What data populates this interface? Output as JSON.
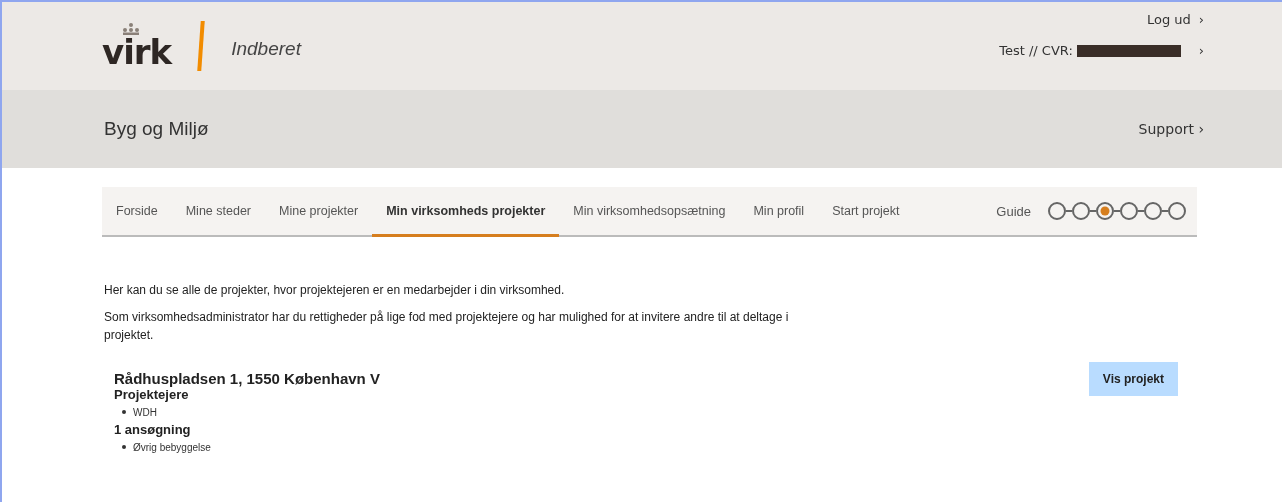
{
  "header": {
    "logo_text": "virk",
    "app_name": "Indberet",
    "logout": "Log ud",
    "chevron_logout": "›",
    "user": "Test // CVR:",
    "chevron_user": "›"
  },
  "subheader": {
    "title": "Byg og Miljø",
    "support": "Support ›"
  },
  "tabs": [
    {
      "label": "Forside",
      "selected": false
    },
    {
      "label": "Mine steder",
      "selected": false
    },
    {
      "label": "Mine projekter",
      "selected": false
    },
    {
      "label": "Min virksomheds projekter",
      "selected": true
    },
    {
      "label": "Min virksomhedsopsætning",
      "selected": false
    },
    {
      "label": "Min profil",
      "selected": false
    },
    {
      "label": "Start projekt",
      "selected": false
    }
  ],
  "guide": {
    "label": "Guide",
    "steps": [
      {
        "selected": false
      },
      {
        "selected": false
      },
      {
        "selected": true
      },
      {
        "selected": false
      },
      {
        "selected": false
      },
      {
        "selected": false
      }
    ]
  },
  "intro": [
    "Her kan du se alle de projekter, hvor projektejeren er en medarbejder i din virksomhed.",
    "Som virksomhedsadministrator har du rettigheder på lige fod med projektejere og har mulighed for at invitere andre til at deltage i projektet."
  ],
  "projects": [
    {
      "address": "Rådhuspladsen 1, 1550 København V",
      "owners_heading": "Projektejere",
      "owners": [
        "WDH"
      ],
      "applications_heading": "1 ansøgning",
      "applications": [
        "Øvrig bebyggelse"
      ],
      "button": "Vis projekt"
    }
  ]
}
